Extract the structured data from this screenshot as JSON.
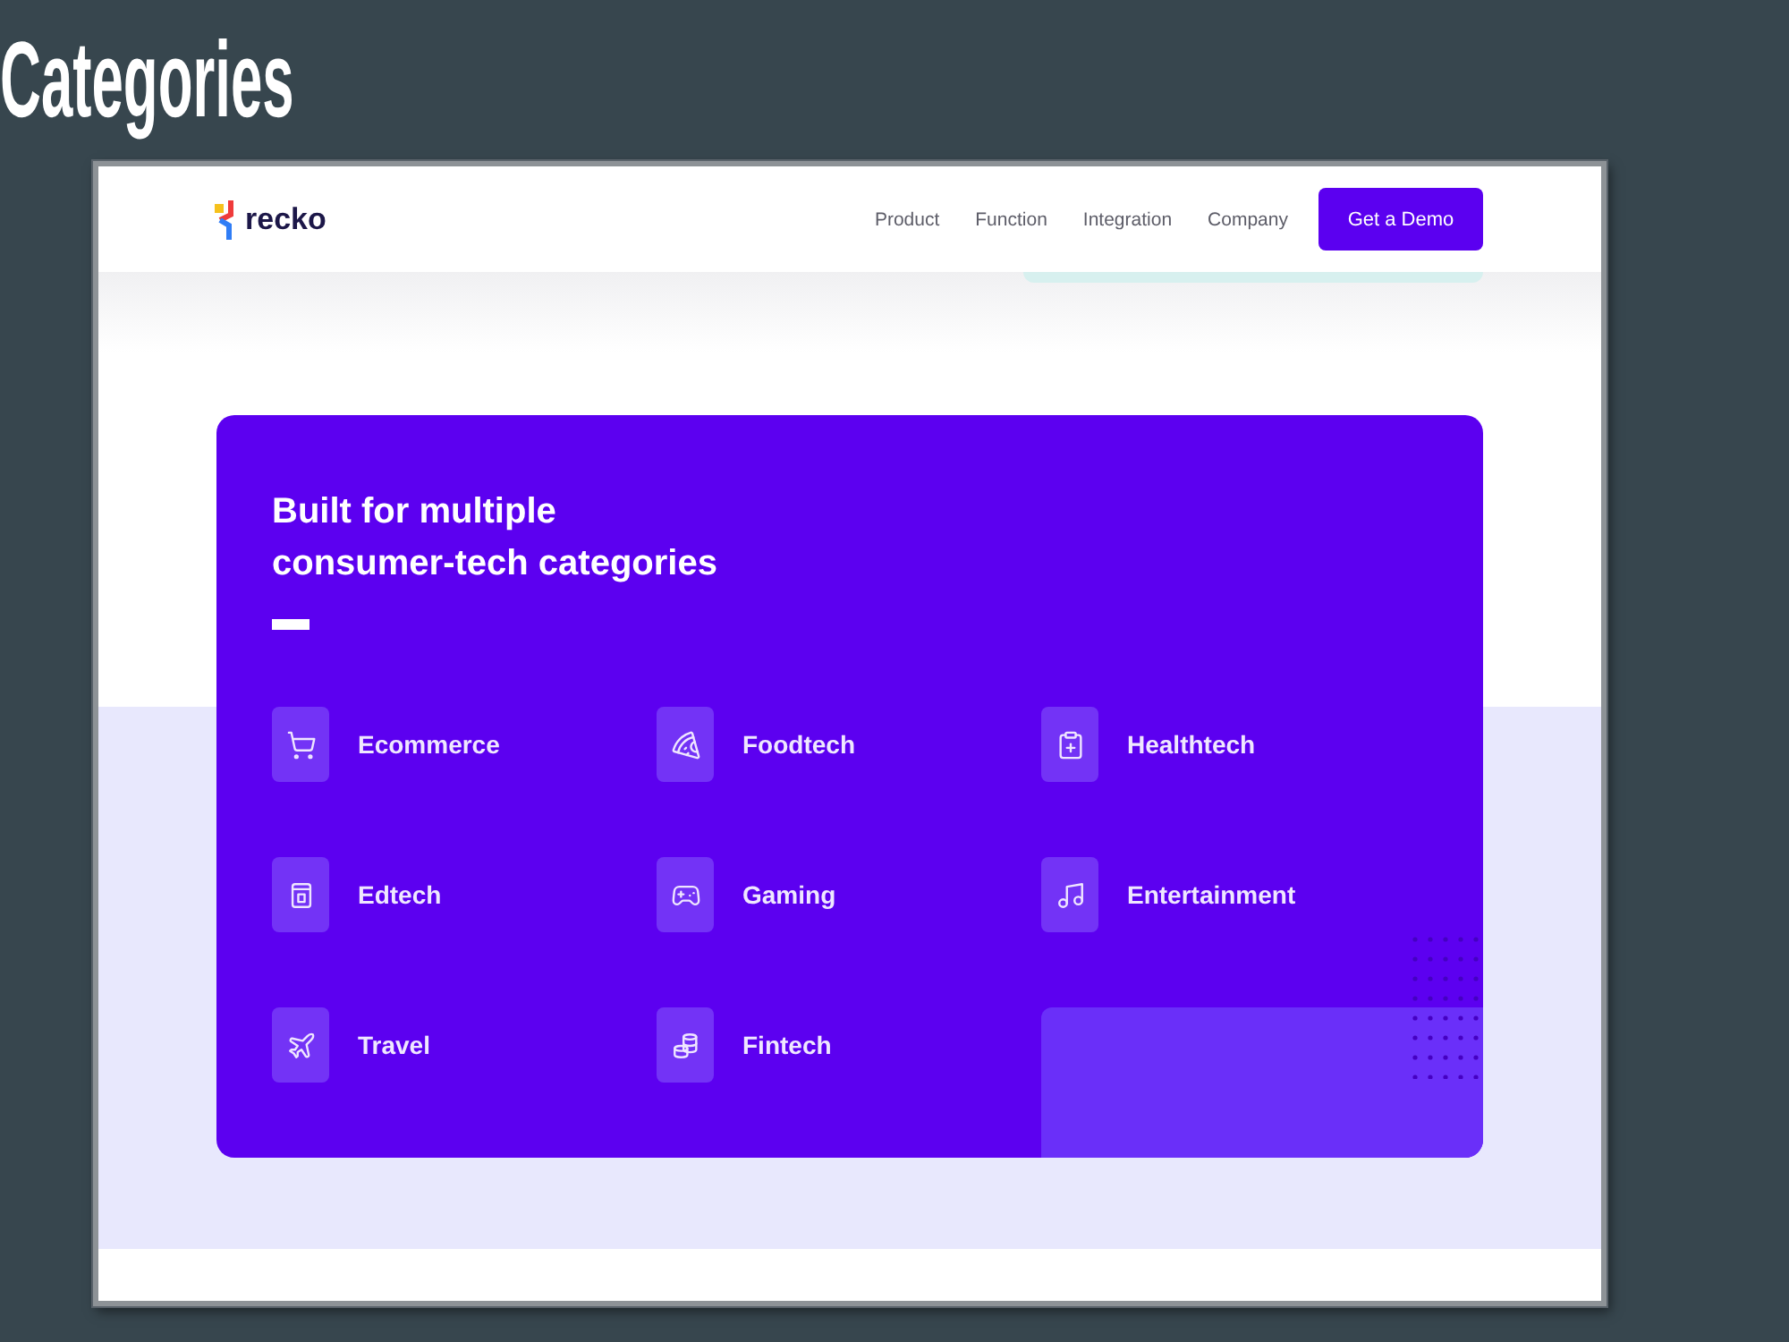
{
  "title": "Categories",
  "site": {
    "logo": "recko",
    "nav": [
      "Product",
      "Function",
      "Integration",
      "Company"
    ],
    "cta": "Get a Demo"
  },
  "section": {
    "heading": "Built for multiple consumer-tech categories",
    "categories": [
      "Ecommerce",
      "Foodtech",
      "Healthtech",
      "Edtech",
      "Gaming",
      "Entertainment",
      "Travel",
      "Fintech"
    ]
  }
}
